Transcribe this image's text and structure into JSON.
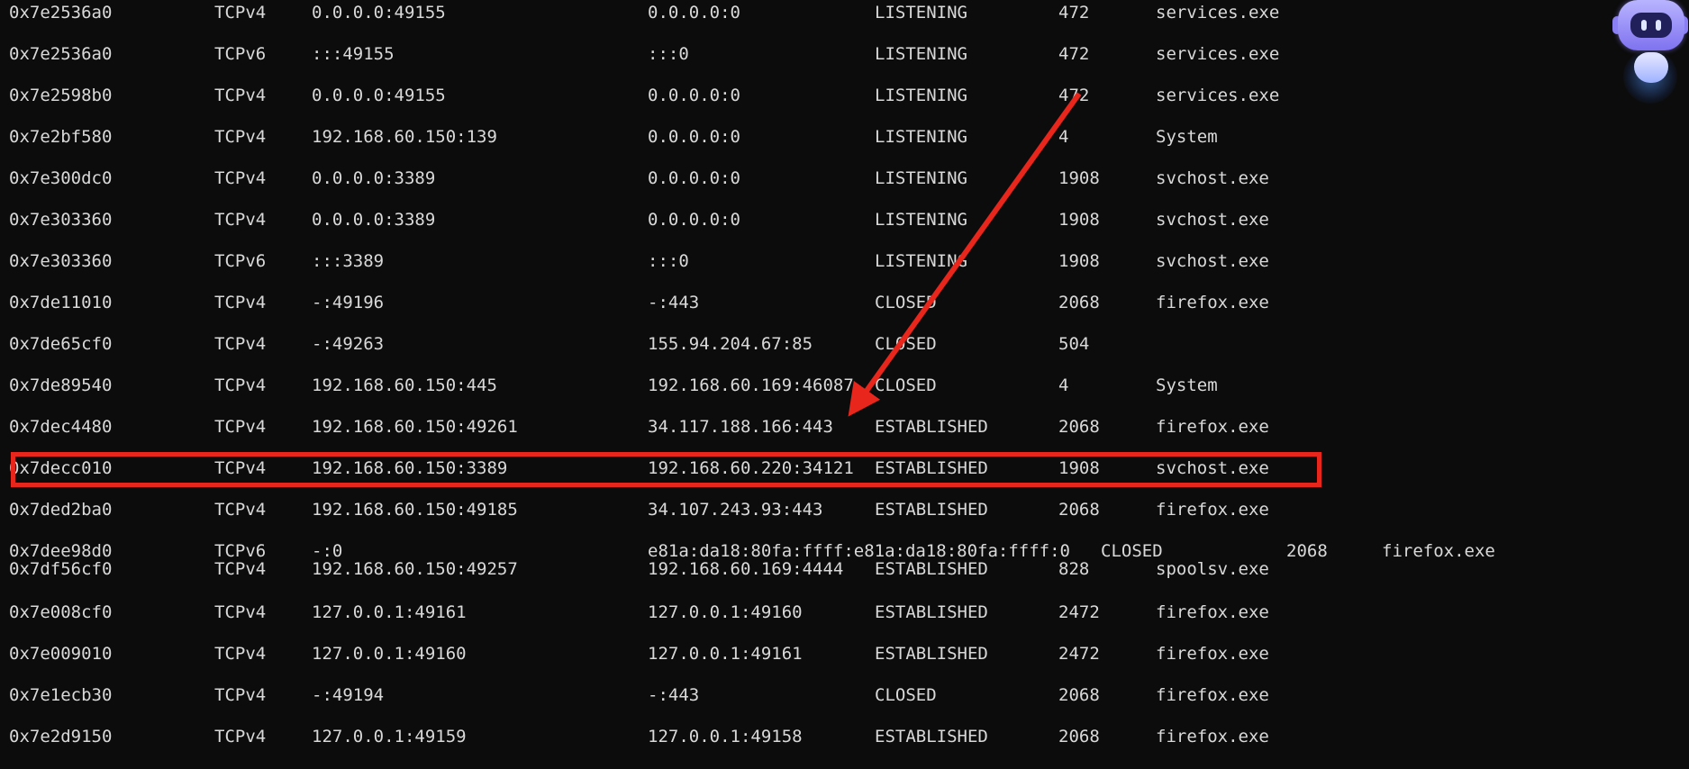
{
  "connections": [
    {
      "offset": "0x7e2536a0",
      "proto": "TCPv4",
      "local": "0.0.0.0:49155",
      "foreign": "0.0.0.0:0",
      "state": "LISTENING",
      "pid": "472",
      "owner": "services.exe"
    },
    {
      "offset": "0x7e2536a0",
      "proto": "TCPv6",
      "local": ":::49155",
      "foreign": ":::0",
      "state": "LISTENING",
      "pid": "472",
      "owner": "services.exe"
    },
    {
      "offset": "0x7e2598b0",
      "proto": "TCPv4",
      "local": "0.0.0.0:49155",
      "foreign": "0.0.0.0:0",
      "state": "LISTENING",
      "pid": "472",
      "owner": "services.exe"
    },
    {
      "offset": "0x7e2bf580",
      "proto": "TCPv4",
      "local": "192.168.60.150:139",
      "foreign": "0.0.0.0:0",
      "state": "LISTENING",
      "pid": "4",
      "owner": "System"
    },
    {
      "offset": "0x7e300dc0",
      "proto": "TCPv4",
      "local": "0.0.0.0:3389",
      "foreign": "0.0.0.0:0",
      "state": "LISTENING",
      "pid": "1908",
      "owner": "svchost.exe"
    },
    {
      "offset": "0x7e303360",
      "proto": "TCPv4",
      "local": "0.0.0.0:3389",
      "foreign": "0.0.0.0:0",
      "state": "LISTENING",
      "pid": "1908",
      "owner": "svchost.exe"
    },
    {
      "offset": "0x7e303360",
      "proto": "TCPv6",
      "local": ":::3389",
      "foreign": ":::0",
      "state": "LISTENING",
      "pid": "1908",
      "owner": "svchost.exe"
    },
    {
      "offset": "0x7de11010",
      "proto": "TCPv4",
      "local": "-:49196",
      "foreign": "-:443",
      "state": "CLOSED",
      "pid": "2068",
      "owner": "firefox.exe"
    },
    {
      "offset": "0x7de65cf0",
      "proto": "TCPv4",
      "local": "-:49263",
      "foreign": "155.94.204.67:85",
      "state": "CLOSED",
      "pid": "504",
      "owner": ""
    },
    {
      "offset": "0x7de89540",
      "proto": "TCPv4",
      "local": "192.168.60.150:445",
      "foreign": "192.168.60.169:46087",
      "state": "CLOSED",
      "pid": "4",
      "owner": "System"
    },
    {
      "offset": "0x7dec4480",
      "proto": "TCPv4",
      "local": "192.168.60.150:49261",
      "foreign": "34.117.188.166:443",
      "state": "ESTABLISHED",
      "pid": "2068",
      "owner": "firefox.exe"
    },
    {
      "offset": "0x7decc010",
      "proto": "TCPv4",
      "local": "192.168.60.150:3389",
      "foreign": "192.168.60.220:34121",
      "state": "ESTABLISHED",
      "pid": "1908",
      "owner": "svchost.exe"
    },
    {
      "offset": "0x7ded2ba0",
      "proto": "TCPv4",
      "local": "192.168.60.150:49185",
      "foreign": "34.107.243.93:443",
      "state": "ESTABLISHED",
      "pid": "2068",
      "owner": "firefox.exe"
    },
    {
      "offset": "0x7dee98d0",
      "proto": "TCPv6",
      "local": "-:0",
      "foreign": "e81a:da18:80fa:ffff:e81a:da18:80fa:ffff:0",
      "state": "CLOSED",
      "pid": "2068",
      "owner": "firefox.exe"
    },
    {
      "offset": "0x7df56cf0",
      "proto": "TCPv4",
      "local": "192.168.60.150:49257",
      "foreign": "192.168.60.169:4444",
      "state": "ESTABLISHED",
      "pid": "828",
      "owner": "spoolsv.exe"
    },
    {
      "offset": "0x7e008cf0",
      "proto": "TCPv4",
      "local": "127.0.0.1:49161",
      "foreign": "127.0.0.1:49160",
      "state": "ESTABLISHED",
      "pid": "2472",
      "owner": "firefox.exe"
    },
    {
      "offset": "0x7e009010",
      "proto": "TCPv4",
      "local": "127.0.0.1:49160",
      "foreign": "127.0.0.1:49161",
      "state": "ESTABLISHED",
      "pid": "2472",
      "owner": "firefox.exe"
    },
    {
      "offset": "0x7e1ecb30",
      "proto": "TCPv4",
      "local": "-:49194",
      "foreign": "-:443",
      "state": "CLOSED",
      "pid": "2068",
      "owner": "firefox.exe"
    },
    {
      "offset": "0x7e2d9150",
      "proto": "TCPv4",
      "local": "127.0.0.1:49159",
      "foreign": "127.0.0.1:49158",
      "state": "ESTABLISHED",
      "pid": "2068",
      "owner": "firefox.exe"
    }
  ],
  "annotations": {
    "highlight_color": "#e8261b",
    "highlighted_offset": "0x7decc010"
  },
  "mascot": {
    "icon": "robot-mascot-icon"
  }
}
